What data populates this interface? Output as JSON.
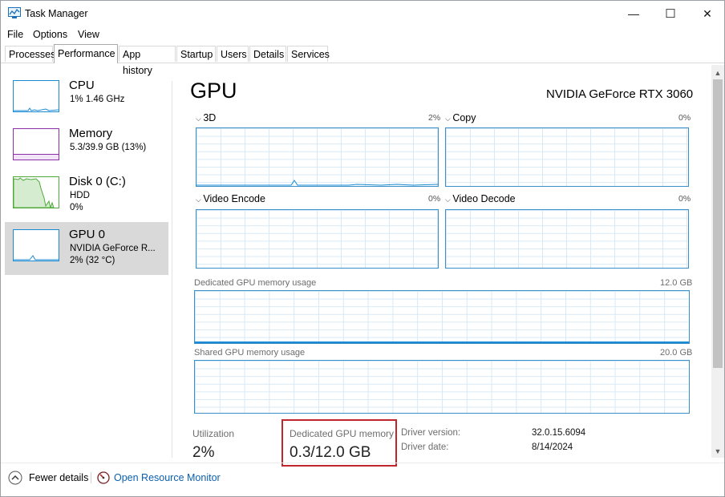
{
  "window": {
    "title": "Task Manager",
    "minimize": "—",
    "maximize": "☐",
    "close": "✕"
  },
  "menu": [
    "File",
    "Options",
    "View"
  ],
  "tabs": [
    "Processes",
    "Performance",
    "App history",
    "Startup",
    "Users",
    "Details",
    "Services"
  ],
  "active_tab": "Performance",
  "sidebar": [
    {
      "title": "CPU",
      "sub1": "1% 1.46 GHz",
      "sub2": "",
      "sub3": ""
    },
    {
      "title": "Memory",
      "sub1": "5.3/39.9 GB (13%)",
      "sub2": "",
      "sub3": ""
    },
    {
      "title": "Disk 0 (C:)",
      "sub1": "HDD",
      "sub2": "0%",
      "sub3": ""
    },
    {
      "title": "GPU 0",
      "sub1": "NVIDIA GeForce R...",
      "sub2": "2% (32 °C)",
      "sub3": ""
    }
  ],
  "main": {
    "title": "GPU",
    "model": "NVIDIA GeForce RTX 3060",
    "engines": [
      {
        "label": "3D",
        "pct": "2%"
      },
      {
        "label": "Copy",
        "pct": "0%"
      },
      {
        "label": "Video Encode",
        "pct": "0%"
      },
      {
        "label": "Video Decode",
        "pct": "0%"
      }
    ],
    "dedicated_mem_label": "Dedicated GPU memory usage",
    "dedicated_mem_max": "12.0 GB",
    "shared_mem_label": "Shared GPU memory usage",
    "shared_mem_max": "20.0 GB",
    "stats": {
      "utilization_label": "Utilization",
      "utilization_value": "2%",
      "dedicated_label": "Dedicated GPU memory",
      "dedicated_value": "0.3/12.0 GB",
      "driver_version_label": "Driver version:",
      "driver_version": "32.0.15.6094",
      "driver_date_label": "Driver date:",
      "driver_date": "8/14/2024"
    }
  },
  "footer": {
    "fewer_details": "Fewer details",
    "open_resource_monitor": "Open Resource Monitor"
  },
  "colors": {
    "cpu": "#1a8ad4",
    "memory": "#8b2fa8",
    "disk": "#4fa93b",
    "gpu": "#1a8ad4",
    "highlight": "#c0272d",
    "selected": "#d9d9d9"
  }
}
